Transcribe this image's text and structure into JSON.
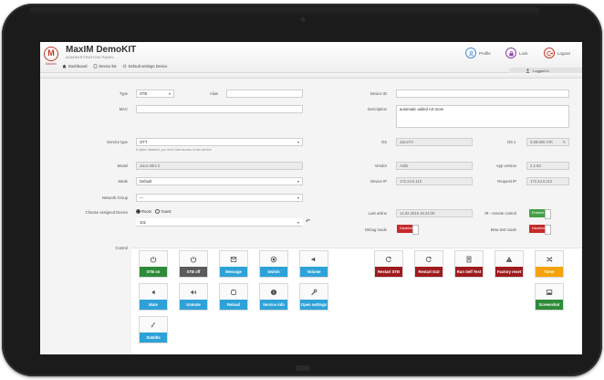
{
  "header": {
    "brand_title": "MaxIM DemoKIT",
    "brand_subtitle": "ADMINISTRATION PANEL",
    "logo_text": "M",
    "logo_caption": "Maxlnfo",
    "nav": [
      {
        "label": "Dashboard",
        "icon": "home-icon"
      },
      {
        "label": "Device list",
        "icon": "tablet-icon"
      },
      {
        "label": "Default settings Device",
        "icon": "cogs-icon"
      }
    ],
    "profile_label": "Profile",
    "lock_label": "Lock",
    "logout_label": "Logout",
    "logged_in_label": "Logged in"
  },
  "form": {
    "type_label": "Type",
    "type_value": "STB",
    "alias_label": "Alias",
    "alias_value": "",
    "mac_label": "MAC",
    "mac_value": "",
    "device_id_label": "Device ID",
    "device_id_value": "",
    "description_label": "Description",
    "description_value": "automatic added AS room",
    "service_type_label": "Service type",
    "service_type_value": "OTT",
    "service_type_hint": "If option disabled, you don't have access to this service",
    "os_label": "OS",
    "os_value": "JuiceTV",
    "os_version_label": "OS v.",
    "os_version_value": "3.58.500 ATK",
    "model_label": "Model",
    "model_value": "Juice Mini 2",
    "vendor_label": "Vendor",
    "vendor_value": "Antik",
    "app_version_label": "App version",
    "app_version_value": "2.2.93",
    "mode_label": "Mode",
    "mode_value": "Default",
    "device_ip_label": "Device IP",
    "device_ip_value": "172.24.0.112",
    "request_ip_label": "Request IP",
    "request_ip_value": "172.24.0.112",
    "network_group_label": "Network Group",
    "network_group_value": "---",
    "choose_device_label": "Choose assigned Device",
    "radio_room": "Room",
    "radio_guest": "Guest",
    "device_select_value": "101",
    "last_online_label": "Last online",
    "last_online_value": "14.02.2018 16:43:30",
    "ir_label": "IR - remote control",
    "ir_state": "Enabled",
    "debug_label": "Debug mode",
    "debug_state": "Disabled",
    "beta_label": "Beta test mode",
    "beta_state": "Disabled",
    "control_label": "Control"
  },
  "controls_left": [
    {
      "label": "STB on",
      "icon": "power-icon",
      "color": "#2e8b3a"
    },
    {
      "label": "STB off",
      "icon": "power-icon",
      "color": "#5b5b5b"
    },
    {
      "label": "Message",
      "icon": "message-icon",
      "color": "#2ea2d8"
    },
    {
      "label": "Switch",
      "icon": "record-icon",
      "color": "#2ea2d8"
    },
    {
      "label": "Volume",
      "icon": "volume-icon",
      "color": "#2ea2d8"
    },
    {
      "label": "Mute",
      "icon": "mute-icon",
      "color": "#2ea2d8"
    },
    {
      "label": "Unmute",
      "icon": "unmute-icon",
      "color": "#2ea2d8"
    },
    {
      "label": "Reload",
      "icon": "reload-icon",
      "color": "#2ea2d8"
    },
    {
      "label": "Service info",
      "icon": "info-icon",
      "color": "#2ea2d8"
    },
    {
      "label": "Open settings",
      "icon": "wrench-icon",
      "color": "#2ea2d8"
    },
    {
      "label": "Subtitle",
      "icon": "subtitle-icon",
      "color": "#2ea2d8"
    }
  ],
  "controls_right": [
    {
      "label": "Restart STB",
      "icon": "restart-icon",
      "color": "#9e1b1e"
    },
    {
      "label": "Restart GUI",
      "icon": "restart-icon",
      "color": "#9e1b1e"
    },
    {
      "label": "Run Self Test",
      "icon": "test-icon",
      "color": "#9e1b1e"
    },
    {
      "label": "Factory reset",
      "icon": "warning-icon",
      "color": "#9e1b1e"
    },
    {
      "label": "Tuner",
      "icon": "shuffle-icon",
      "color": "#f4a30a"
    },
    {
      "label": "Screenshot",
      "icon": "image-icon",
      "color": "#2e8b3a"
    }
  ]
}
